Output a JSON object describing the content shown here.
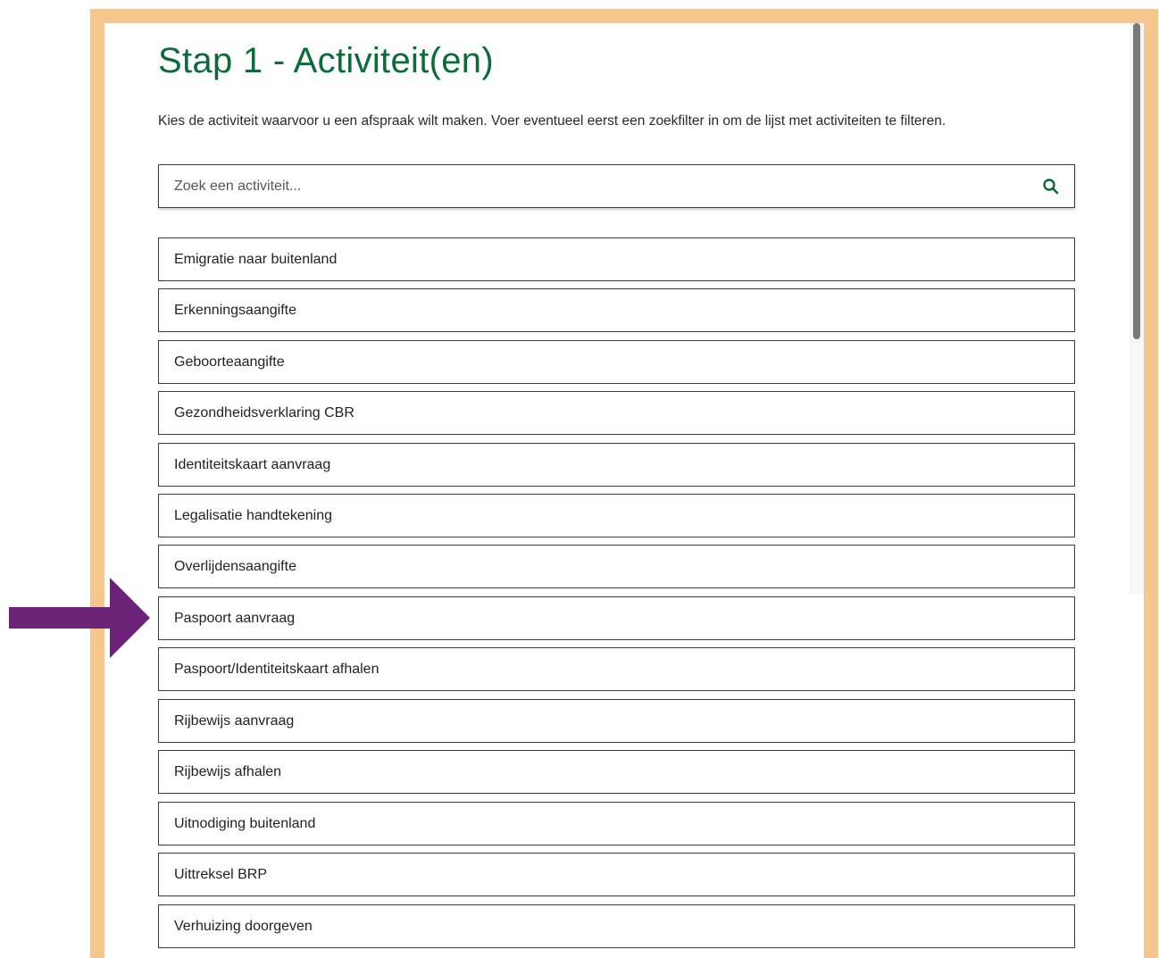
{
  "page": {
    "title": "Stap 1 - Activiteit(en)",
    "intro": "Kies de activiteit waarvoor u een afspraak wilt maken. Voer eventueel eerst een zoekfilter in om de lijst met activiteiten te filteren."
  },
  "search": {
    "placeholder": "Zoek een activiteit...",
    "value": "",
    "icon": "search-icon"
  },
  "activities": [
    "Emigratie naar buitenland",
    "Erkenningsaangifte",
    "Geboorteaangifte",
    "Gezondheidsverklaring CBR",
    "Identiteitskaart aanvraag",
    "Legalisatie handtekening",
    "Overlijdensaangifte",
    "Paspoort aanvraag",
    "Paspoort/Identiteitskaart afhalen",
    "Rijbewijs aanvraag",
    "Rijbewijs afhalen",
    "Uitnodiging buitenland",
    "Uittreksel BRP",
    "Verhuizing doorgeven"
  ],
  "annotation": {
    "arrow_target": "Paspoort aanvraag",
    "arrow_color": "#6b2377"
  },
  "colors": {
    "title": "#0b6b3a",
    "frame": "#f5c78f",
    "search_icon": "#0b6b3a"
  }
}
